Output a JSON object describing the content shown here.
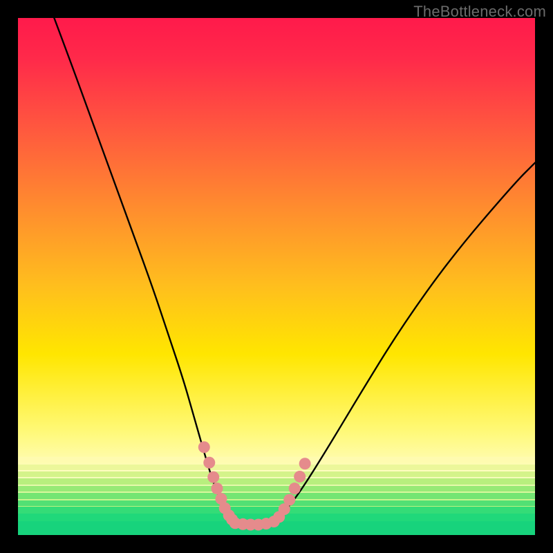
{
  "watermark": {
    "text": "TheBottleneck.com"
  },
  "chart_data": {
    "type": "line",
    "title": "",
    "xlabel": "",
    "ylabel": "",
    "xlim": [
      0,
      100
    ],
    "ylim": [
      0,
      100
    ],
    "legend": false,
    "grid": false,
    "series": [
      {
        "name": "bottleneck-curve",
        "color": "#000000",
        "x": [
          7,
          10,
          14,
          18,
          22,
          26,
          29,
          32,
          34,
          36,
          37.5,
          39,
          40.5,
          42,
          44,
          46,
          48,
          50,
          52,
          55,
          60,
          66,
          74,
          84,
          96,
          100
        ],
        "y": [
          100,
          92,
          81,
          70,
          59,
          48,
          39,
          30,
          23,
          16,
          11,
          7,
          4,
          2.5,
          2,
          2,
          2.3,
          3,
          5,
          9,
          17,
          27,
          40,
          54,
          68,
          72
        ]
      },
      {
        "name": "highlight-dots-left",
        "type": "scatter",
        "color": "#e58b8c",
        "x": [
          36.0,
          37.0,
          37.8,
          38.5,
          39.3,
          40.0,
          40.8,
          41.4
        ],
        "y": [
          17.0,
          14.0,
          11.2,
          9.0,
          7.0,
          5.2,
          3.8,
          3.0
        ]
      },
      {
        "name": "highlight-dots-bottom",
        "type": "scatter",
        "color": "#e58b8c",
        "x": [
          42.0,
          43.5,
          45.0,
          46.5,
          48.0,
          49.5
        ],
        "y": [
          2.3,
          2.1,
          2.0,
          2.0,
          2.2,
          2.6
        ]
      },
      {
        "name": "highlight-dots-right",
        "type": "scatter",
        "color": "#e58b8c",
        "x": [
          50.5,
          51.5,
          52.5,
          53.5,
          54.5,
          55.5
        ],
        "y": [
          3.5,
          5.0,
          6.8,
          9.0,
          11.3,
          13.8
        ]
      }
    ],
    "background_bands": [
      {
        "y_from": 72,
        "y_to": 100,
        "color": "#ff2a4a"
      },
      {
        "y_from": 52,
        "y_to": 72,
        "color": "#ff8a2f"
      },
      {
        "y_from": 30,
        "y_to": 52,
        "color": "#ffd800"
      },
      {
        "y_from": 18,
        "y_to": 30,
        "color": "#fff978"
      },
      {
        "y_from": 12,
        "y_to": 18,
        "color": "#fffdc4"
      },
      {
        "y_from": 4,
        "y_to": 12,
        "color": "#b6f27a"
      },
      {
        "y_from": 0,
        "y_to": 4,
        "color": "#23e07a"
      }
    ],
    "bottom_stripes": [
      {
        "y": 14.0,
        "h": 1.1,
        "color": "#fffbb0"
      },
      {
        "y": 12.6,
        "h": 1.1,
        "color": "#ecf79a"
      },
      {
        "y": 11.2,
        "h": 1.1,
        "color": "#d4f38a"
      },
      {
        "y": 9.8,
        "h": 1.1,
        "color": "#b8ef7e"
      },
      {
        "y": 8.4,
        "h": 1.1,
        "color": "#97ea76"
      },
      {
        "y": 7.0,
        "h": 1.1,
        "color": "#74e573"
      },
      {
        "y": 5.6,
        "h": 1.1,
        "color": "#52e074"
      },
      {
        "y": 4.2,
        "h": 1.3,
        "color": "#34dc77"
      },
      {
        "y": 2.7,
        "h": 1.5,
        "color": "#20d87a"
      },
      {
        "y": 0.0,
        "h": 2.7,
        "color": "#17d37c"
      }
    ]
  }
}
